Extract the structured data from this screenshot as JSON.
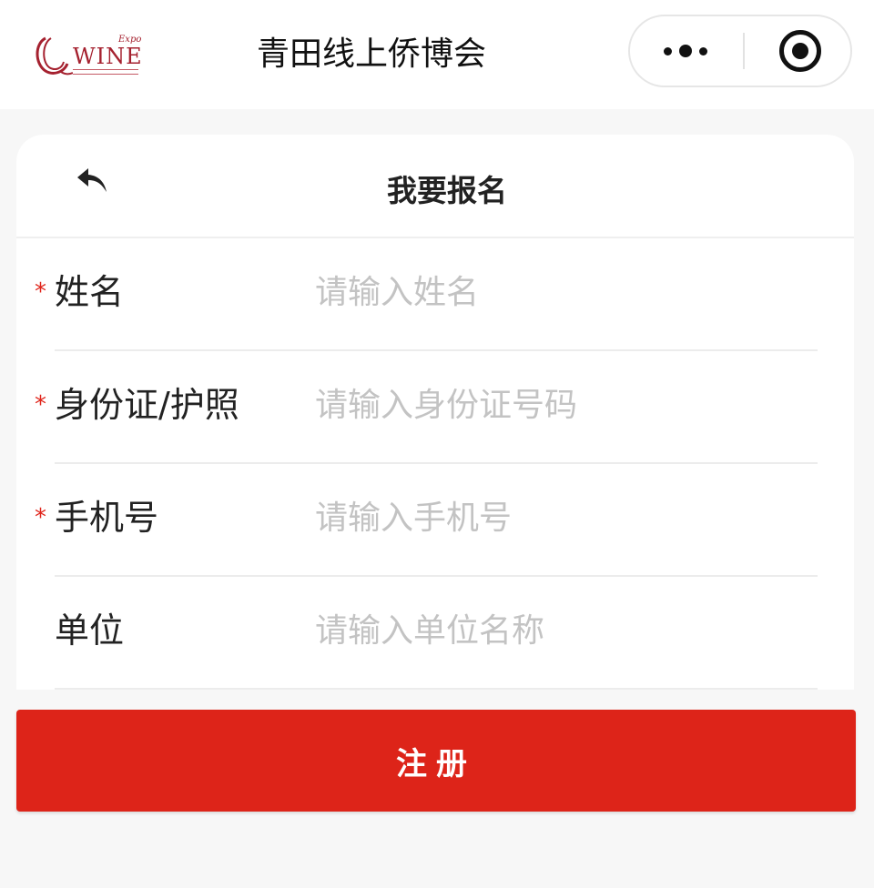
{
  "app": {
    "title": "青田线上侨博会",
    "logo": {
      "word": "WINE",
      "expo": "Expo"
    }
  },
  "capsule": {
    "more_icon": "more-dots-icon",
    "close_icon": "target-close-icon"
  },
  "page": {
    "title": "我要报名",
    "back_icon": "back-arrow-icon"
  },
  "form": {
    "required_mark": "*",
    "fields": [
      {
        "label": "姓名",
        "placeholder": "请输入姓名",
        "value": "",
        "required": true
      },
      {
        "label": "身份证/护照",
        "placeholder": "请输入身份证号码",
        "value": "",
        "required": true
      },
      {
        "label": "手机号",
        "placeholder": "请输入手机号",
        "value": "",
        "required": true
      },
      {
        "label": "单位",
        "placeholder": "请输入单位名称",
        "value": "",
        "required": false
      }
    ],
    "submit_label": "注册"
  },
  "colors": {
    "accent": "#dd2419",
    "required": "#e0261c",
    "brand": "#a5212f",
    "placeholder": "#c3c3c3"
  }
}
